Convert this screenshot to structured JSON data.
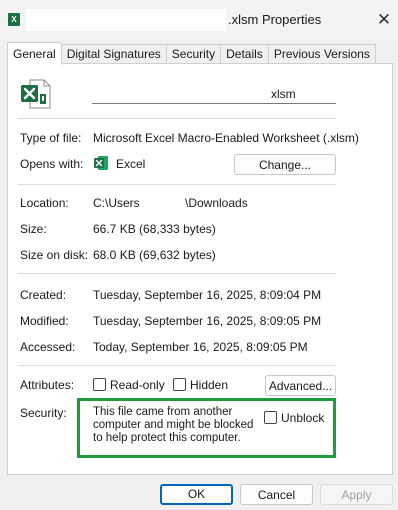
{
  "window": {
    "title": ".xlsm Properties",
    "app_icon_glyph": "X",
    "close_glyph": "✕"
  },
  "tabs": [
    {
      "label": "General",
      "active": true
    },
    {
      "label": "Digital Signatures",
      "active": false
    },
    {
      "label": "Security",
      "active": false
    },
    {
      "label": "Details",
      "active": false
    },
    {
      "label": "Previous Versions",
      "active": false
    }
  ],
  "file": {
    "name_value": "xlsm",
    "icon": "excel-file-icon"
  },
  "general": {
    "type_label": "Type of file:",
    "type_value": "Microsoft Excel Macro-Enabled Worksheet (.xlsm)",
    "opens_label": "Opens with:",
    "opens_value": "Excel",
    "change_button": "Change...",
    "location_label": "Location:",
    "location_prefix": "C:\\Users\\",
    "location_suffix": "\\Downloads",
    "size_label": "Size:",
    "size_value": "66.7 KB (68,333 bytes)",
    "size_on_disk_label": "Size on disk:",
    "size_on_disk_value": "68.0 KB (69,632 bytes)",
    "created_label": "Created:",
    "created_value": "Tuesday, September 16, 2025, 8:09:04 PM",
    "modified_label": "Modified:",
    "modified_value": "Tuesday, September 16, 2025, 8:09:05 PM",
    "accessed_label": "Accessed:",
    "accessed_value": "Today, September 16, 2025, 8:09:05 PM",
    "attributes_label": "Attributes:",
    "readonly_label": "Read-only",
    "hidden_label": "Hidden",
    "advanced_button": "Advanced...",
    "security_label": "Security:",
    "security_text": "This file came from another computer and might be blocked to help protect this computer.",
    "unblock_label": "Unblock"
  },
  "footer": {
    "ok": "OK",
    "cancel": "Cancel",
    "apply": "Apply"
  },
  "colors": {
    "excel_green": "#1d6f42",
    "highlight_green": "#1a9d3a",
    "primary_blue": "#0067c0"
  }
}
